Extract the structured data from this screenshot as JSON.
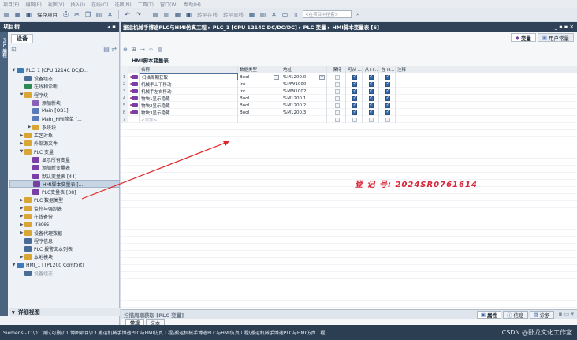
{
  "menu": [
    "项目(P)",
    "编辑(E)",
    "视图(V)",
    "插入(I)",
    "在线(O)",
    "选项(N)",
    "工具(T)",
    "窗口(W)",
    "帮助(H)"
  ],
  "toolbar": {
    "save_project": "保存项目",
    "go_online": "转至在线",
    "go_offline": "转至离线",
    "search_placeholder": "<在项目中搜索>"
  },
  "left_panel": {
    "title": "项目树",
    "devices_tab": "设备",
    "side_label": "PLC 编程",
    "detail_view": "详细视图",
    "tree": [
      {
        "label": "PLC_1 [CPU 1214C DC/D...",
        "indent": 0,
        "arrow": "▼",
        "color": "#3c7ab8",
        "selected": false
      },
      {
        "label": "设备组态",
        "indent": 1,
        "arrow": "",
        "color": "#4a6d96",
        "selected": false
      },
      {
        "label": "在线和诊断",
        "indent": 1,
        "arrow": "",
        "color": "#2d8a56",
        "selected": false
      },
      {
        "label": "程序块",
        "indent": 1,
        "arrow": "▼",
        "color": "#d9a636",
        "selected": false
      },
      {
        "label": "添加新块",
        "indent": 2,
        "arrow": "",
        "color": "#8a5fb8",
        "selected": false
      },
      {
        "label": "Main [OB1]",
        "indent": 2,
        "arrow": "",
        "color": "#5c7bb8",
        "selected": false
      },
      {
        "label": "Main_HMI简单 [...",
        "indent": 2,
        "arrow": "",
        "color": "#5c7bb8",
        "selected": false
      },
      {
        "label": "系统块",
        "indent": 2,
        "arrow": "▶",
        "color": "#d9a636",
        "selected": false
      },
      {
        "label": "工艺对象",
        "indent": 1,
        "arrow": "▶",
        "color": "#d9a636",
        "selected": false
      },
      {
        "label": "外部源文件",
        "indent": 1,
        "arrow": "▶",
        "color": "#d9a636",
        "selected": false
      },
      {
        "label": "PLC 变量",
        "indent": 1,
        "arrow": "▼",
        "color": "#d9a636",
        "selected": false
      },
      {
        "label": "显示所有变量",
        "indent": 2,
        "arrow": "",
        "color": "#7a3fa6",
        "selected": false
      },
      {
        "label": "添加新变量表",
        "indent": 2,
        "arrow": "",
        "color": "#7a3fa6",
        "selected": false
      },
      {
        "label": "默认变量表 [44]",
        "indent": 2,
        "arrow": "",
        "color": "#7a3fa6",
        "selected": false
      },
      {
        "label": "HMI脚本变量表 [...",
        "indent": 2,
        "arrow": "",
        "color": "#7a3fa6",
        "selected": true
      },
      {
        "label": "PLC变量表 [38]",
        "indent": 2,
        "arrow": "",
        "color": "#7a3fa6",
        "selected": false
      },
      {
        "label": "PLC 数据类型",
        "indent": 1,
        "arrow": "▶",
        "color": "#d9a636",
        "selected": false
      },
      {
        "label": "监控与强制表",
        "indent": 1,
        "arrow": "▶",
        "color": "#d9a636",
        "selected": false
      },
      {
        "label": "在线备份",
        "indent": 1,
        "arrow": "▶",
        "color": "#d9a636",
        "selected": false
      },
      {
        "label": "Traces",
        "indent": 1,
        "arrow": "▶",
        "color": "#d9a636",
        "selected": false
      },
      {
        "label": "设备代理数据",
        "indent": 1,
        "arrow": "▶",
        "color": "#d9a636",
        "selected": false
      },
      {
        "label": "程序信息",
        "indent": 1,
        "arrow": "",
        "color": "#4a6d96",
        "selected": false
      },
      {
        "label": "PLC 报警文本列表",
        "indent": 1,
        "arrow": "",
        "color": "#4a6d96",
        "selected": false
      },
      {
        "label": "本地模块",
        "indent": 1,
        "arrow": "▶",
        "color": "#d9a636",
        "selected": false
      },
      {
        "label": "HMI_1 [TP1200 Comfort]",
        "indent": 0,
        "arrow": "▼",
        "color": "#3c7ab8",
        "selected": false
      },
      {
        "label": "设备组态",
        "indent": 1,
        "arrow": "",
        "color": "#4a6d96",
        "selected": false,
        "dim": true
      }
    ]
  },
  "main": {
    "breadcrumb": "搬运机械手博途PLC与HMI仿真工程 ▸ PLC_1 [CPU 1214C DC/DC/DC] ▸ PLC 变量 ▸ HMI脚本变量表 [6]",
    "window_controls": "_ ▪ ▪ ✕",
    "view_tabs": {
      "tags": "变量",
      "user_constants": "用户常量"
    },
    "table_title": "HMI脚本变量表",
    "columns": {
      "name": "名称",
      "type": "数据类型",
      "address": "地址",
      "retain": "保持",
      "hmi_access": "可从 ...",
      "hmi_write": "从 H...",
      "hmi_visible": "在 H...",
      "comment": "注释"
    },
    "rows": [
      {
        "num": "1",
        "name": "扫描周期获取",
        "type": "Bool",
        "address": "%M1200.0",
        "access": true,
        "write": true,
        "visible": true
      },
      {
        "num": "2",
        "name": "机械手上下移动",
        "type": "Int",
        "address": "%MW1000",
        "access": true,
        "write": true,
        "visible": true
      },
      {
        "num": "3",
        "name": "机械手左右移动",
        "type": "Int",
        "address": "%MW1002",
        "access": true,
        "write": true,
        "visible": true
      },
      {
        "num": "4",
        "name": "物块1显示隐藏",
        "type": "Bool",
        "address": "%M1200.1",
        "access": true,
        "write": true,
        "visible": true
      },
      {
        "num": "5",
        "name": "物块2显示隐藏",
        "type": "Bool",
        "address": "%M1200.2",
        "access": true,
        "write": true,
        "visible": true
      },
      {
        "num": "6",
        "name": "物块3显示隐藏",
        "type": "Bool",
        "address": "%M1200.3",
        "access": true,
        "write": true,
        "visible": true
      }
    ],
    "add_row": {
      "num": "7",
      "label": "<添加>"
    },
    "watermark": "登 记 号:  2024SR0761614"
  },
  "inspector": {
    "title": "扫描周期获取 [PLC 变量]",
    "tabs": {
      "properties": "属性",
      "info": "信息",
      "diagnostics": "诊断"
    },
    "sub_tabs": [
      "常规",
      "文本"
    ]
  },
  "statusbar": {
    "text": "Siemens - C:\\01.测试可删\\01.博图项目\\13.搬运机械手博途PLC与HMI仿真工程\\搬运机械手博途PLC与HMI仿真工程\\搬运机械手博途PLC与HMI仿真工程",
    "watermark": "CSDN @卧龙文化工作室"
  },
  "colors": {
    "header_dark": "#2f4257",
    "accent_blue": "#3468a8",
    "watermark_red": "#d8263a",
    "annotation_arrow": "#e02828"
  }
}
